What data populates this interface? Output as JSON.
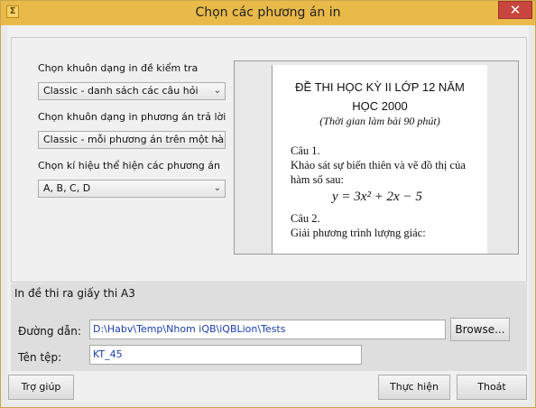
{
  "window": {
    "title": "Chọn các phương án in",
    "close_glyph": "✕",
    "app_icon": "app-icon"
  },
  "options": {
    "exam_format_label": "Chọn khuôn dạng in đề kiểm tra",
    "exam_format_value": "Classic - danh sách các câu hỏi",
    "answer_format_label": "Chọn khuôn dạng in phương án trả lời",
    "answer_format_value": "Classic - mỗi phương án trên một hàng",
    "symbol_label": "Chọn kí hiệu thể hiện các phương án",
    "symbol_value": "A, B, C, D"
  },
  "preview": {
    "title_line1": "ĐỀ THI HỌC KỲ II LỚP 12 NĂM",
    "title_line2": "HỌC 2000",
    "subtitle": "(Thời gian làm bài 90 phút)",
    "q1_label": "Câu 1.",
    "q1_text1": "Khảo sát sự biến thiên và vẽ đồ thị của",
    "q1_text2": "hàm số sau:",
    "q1_formula": "y = 3x² + 2x − 5",
    "q2_label": "Câu 2.",
    "q2_text": "Giải phương trình lượng giác:"
  },
  "print_a3": {
    "label": "In đề thi ra giấy thi A3"
  },
  "path": {
    "label": "Đường dẫn:",
    "value": "D:\\Habv\\Temp\\Nhom iQB\\iQBLion\\Tests",
    "browse": "Browse..."
  },
  "filename": {
    "label": "Tên tệp:",
    "value": "KT_45"
  },
  "buttons": {
    "help": "Trợ giúp",
    "run": "Thực hiện",
    "exit": "Thoát"
  }
}
